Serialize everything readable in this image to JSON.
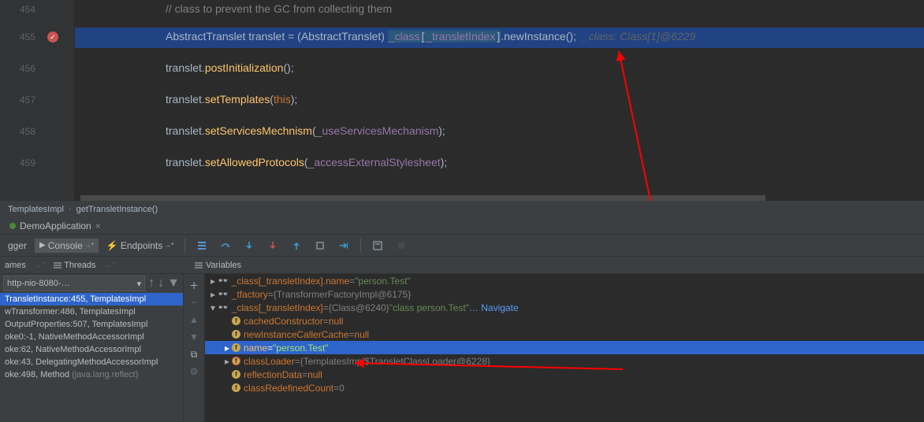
{
  "lines": {
    "l454": "454",
    "l455": "455",
    "l456": "456",
    "l457": "457",
    "l458": "458",
    "l459": "459"
  },
  "code": {
    "c454": "// class to prevent the GC from collecting them",
    "c455_pre": "AbstractTranslet translet = (AbstractTranslet) ",
    "c455_hl1": "_class",
    "c455_hl2": "[",
    "c455_hl3": "_transletIndex",
    "c455_hl4": "]",
    "c455_post": ".newInstance();  ",
    "c455_inlay": "_class: Class[1]@6229",
    "c456_a": "translet.",
    "c456_b": "postInitialization",
    "c456_c": "();",
    "c457_a": "translet.",
    "c457_b": "setTemplates",
    "c457_c": "(",
    "c457_d": "this",
    "c457_e": ");",
    "c458_a": "translet.",
    "c458_b": "setServicesMechnism",
    "c458_c": "(",
    "c458_d": "_useServicesMechanism",
    "c458_e": ");",
    "c459_a": "translet.",
    "c459_b": "setAllowedProtocols",
    "c459_c": "(",
    "c459_d": "_accessExternalStylesheet",
    "c459_e": ");"
  },
  "breadcrumbs": {
    "a": "TemplatesImpl",
    "b": "getTransletInstance()"
  },
  "tabs": {
    "run": "DemoApplication"
  },
  "toolbar": {
    "debugger": "gger",
    "console": "Console",
    "endpoints": "Endpoints"
  },
  "lowerTabs": {
    "frames": "ames",
    "threads": "Threads",
    "variables": "Variables"
  },
  "frames": {
    "thread": "http-nio-8080-…",
    "items": [
      "TransletInstance:455, TemplatesImpl",
      "wTransformer:486, TemplatesImpl",
      "OutputProperties:507, TemplatesImpl",
      "oke0:-1, NativeMethodAccessorImpl",
      "oke:62, NativeMethodAccessorImpl",
      "oke:43, DelegatingMethodAccessorImpl",
      "oke:498, Method"
    ],
    "gray6": "(java.lang.reflect)"
  },
  "vars": {
    "r1a": "_class[_transletIndex].name",
    "r1b": " = ",
    "r1c": "\"person.Test\"",
    "r2a": "_tfactory",
    "r2b": " = ",
    "r2c": "{TransformerFactoryImpl@6175}",
    "r3a": "_class[_transletIndex]",
    "r3b": " = ",
    "r3c": "{Class@6240}",
    "r3d": " \"class person.Test\"",
    "r3e": "… Navigate",
    "r4a": "cachedConstructor",
    "r4b": " = ",
    "r4c": "null",
    "r5a": "newInstanceCallerCache",
    "r5b": " = ",
    "r5c": "null",
    "r6a": "name",
    "r6b": " = ",
    "r6c": "\"person.Test\"",
    "r7a": "classLoader",
    "r7b": " = ",
    "r7c": "{TemplatesImpl$TransletClassLoader@6228}",
    "r8a": "reflectionData",
    "r8b": " = ",
    "r8c": "null",
    "r9a": "classRedefinedCount",
    "r9b": " = ",
    "r9c": "0"
  }
}
